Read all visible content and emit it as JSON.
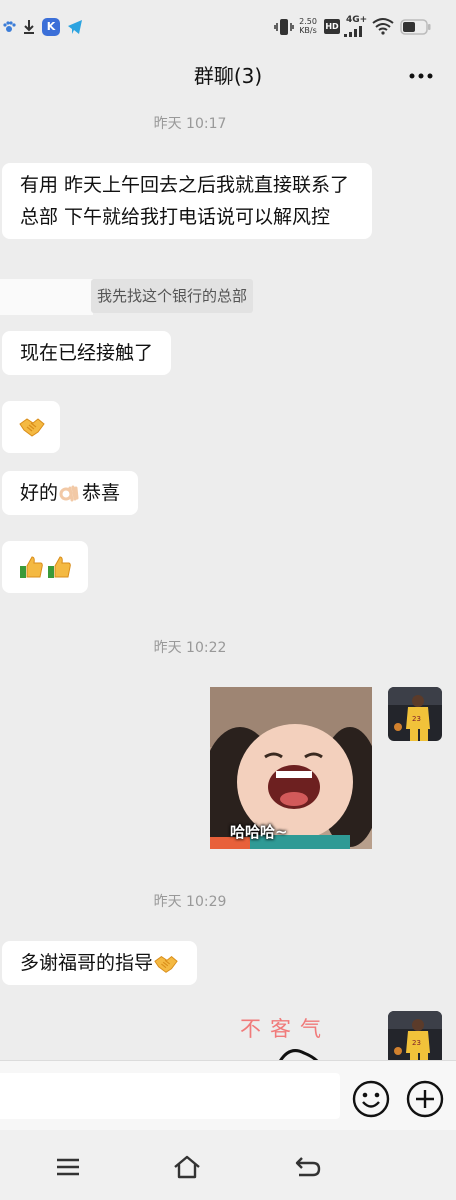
{
  "status_bar": {
    "net_speed_value": "2.50",
    "net_speed_unit": "KB/s",
    "hd_label": "HD",
    "network_label": "4G+",
    "left_app_badge": "K"
  },
  "header": {
    "title": "群聊(3)"
  },
  "timestamps": {
    "t1": "昨天 10:17",
    "t2": "昨天 10:22",
    "t3": "昨天 10:29"
  },
  "messages": {
    "m1": "有用  昨天上午回去之后我就直接联系了总部 下午就给我打电话说可以解风控",
    "quote": "我先找这个银行的总部",
    "m2": "现在已经接触了",
    "m4_text_a": "好的",
    "m4_text_b": "恭喜",
    "m6": "多谢福哥的指导"
  },
  "sticker": {
    "caption": "哈哈哈~"
  },
  "sticker2": {
    "caption": "不客气"
  },
  "input": {
    "placeholder": ""
  },
  "colors": {
    "background": "#ededed",
    "bubble_in": "#ffffff",
    "timestamp": "#999999",
    "quote_bg": "#e2e2e2"
  },
  "icons": {
    "emoji_button": "smiley-icon",
    "plus_button": "plus-icon",
    "nav_menu": "menu-icon",
    "nav_home": "home-icon",
    "nav_back": "back-icon"
  }
}
